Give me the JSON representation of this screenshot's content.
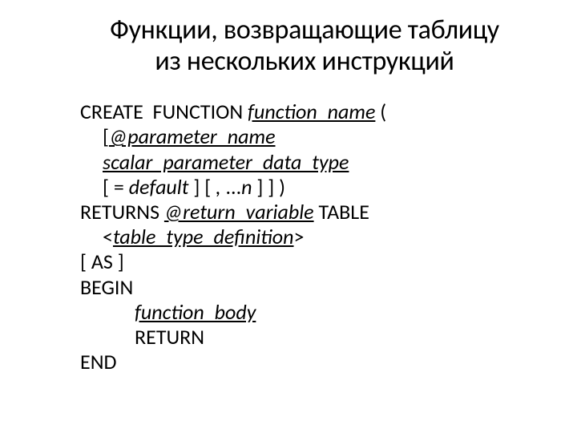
{
  "slide": {
    "title_line1": "Функции, возвращающие таблицу",
    "title_line2": "из нескольких инструкций",
    "code": {
      "l1_a": "CREATE  FUNCTION ",
      "l1_b": "function_name",
      "l1_c": " (",
      "l2_a": "[",
      "l2_b": "@parameter_name",
      "l3": "scalar_parameter_data_type",
      "l4_a": "[ = ",
      "l4_b": "default",
      "l4_c": " ] [ ",
      "l4_d": ",",
      "l4_e": " ...",
      "l4_f": "n",
      "l4_g": " ] ] )",
      "l5_a": "RETURNS ",
      "l5_b": "@return_variable",
      "l5_c": " TABLE",
      "l6_a": "<",
      "l6_b": "table_type_definition",
      "l6_c": ">",
      "l7": "[ AS ]",
      "l8": "BEGIN",
      "l9": "function_body",
      "l10": "RETURN",
      "l11": "END"
    }
  }
}
